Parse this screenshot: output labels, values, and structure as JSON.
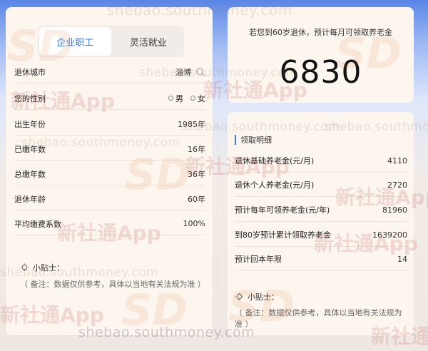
{
  "tabs": [
    {
      "label": "企业职工",
      "active": true
    },
    {
      "label": "灵活就业",
      "active": false
    }
  ],
  "form": {
    "city_label": "退休城市",
    "city_value": "淄博",
    "gender_label": "您的性别",
    "gender_options": [
      "男",
      "女"
    ],
    "birth_label": "出生年份",
    "birth_value": "1985年",
    "paid_years_label": "已缴年数",
    "paid_years_value": "16年",
    "total_years_label": "总缴年数",
    "total_years_value": "36年",
    "retire_age_label": "退休年龄",
    "retire_age_value": "60年",
    "avg_index_label": "平均缴费系数",
    "avg_index_value": "100%"
  },
  "tip": {
    "title": "小贴士：",
    "text": "（ 备注：数据仅供参考，具体以当地有关法规为准 ）"
  },
  "result": {
    "caption": "若您到60岁退休，预计每月可领取养老金",
    "amount": "6830"
  },
  "details": {
    "title": "领取明细",
    "rows": [
      {
        "label": "退休基础养老金(元/月)",
        "value": "4110"
      },
      {
        "label": "退休个人养老金(元/月)",
        "value": "2720"
      },
      {
        "label": "预计每年可领养老金(元/年)",
        "value": "81960"
      },
      {
        "label": "到80岁预计累计领取养老金",
        "value": "1639200"
      },
      {
        "label": "预计回本年限",
        "value": "14"
      }
    ]
  },
  "watermarks": {
    "url": "shebao.southmoney.com",
    "brand": "新社通App",
    "logo": "SD"
  },
  "colors": {
    "accent": "#3a7ad9",
    "panel": "#fdf6ef"
  }
}
